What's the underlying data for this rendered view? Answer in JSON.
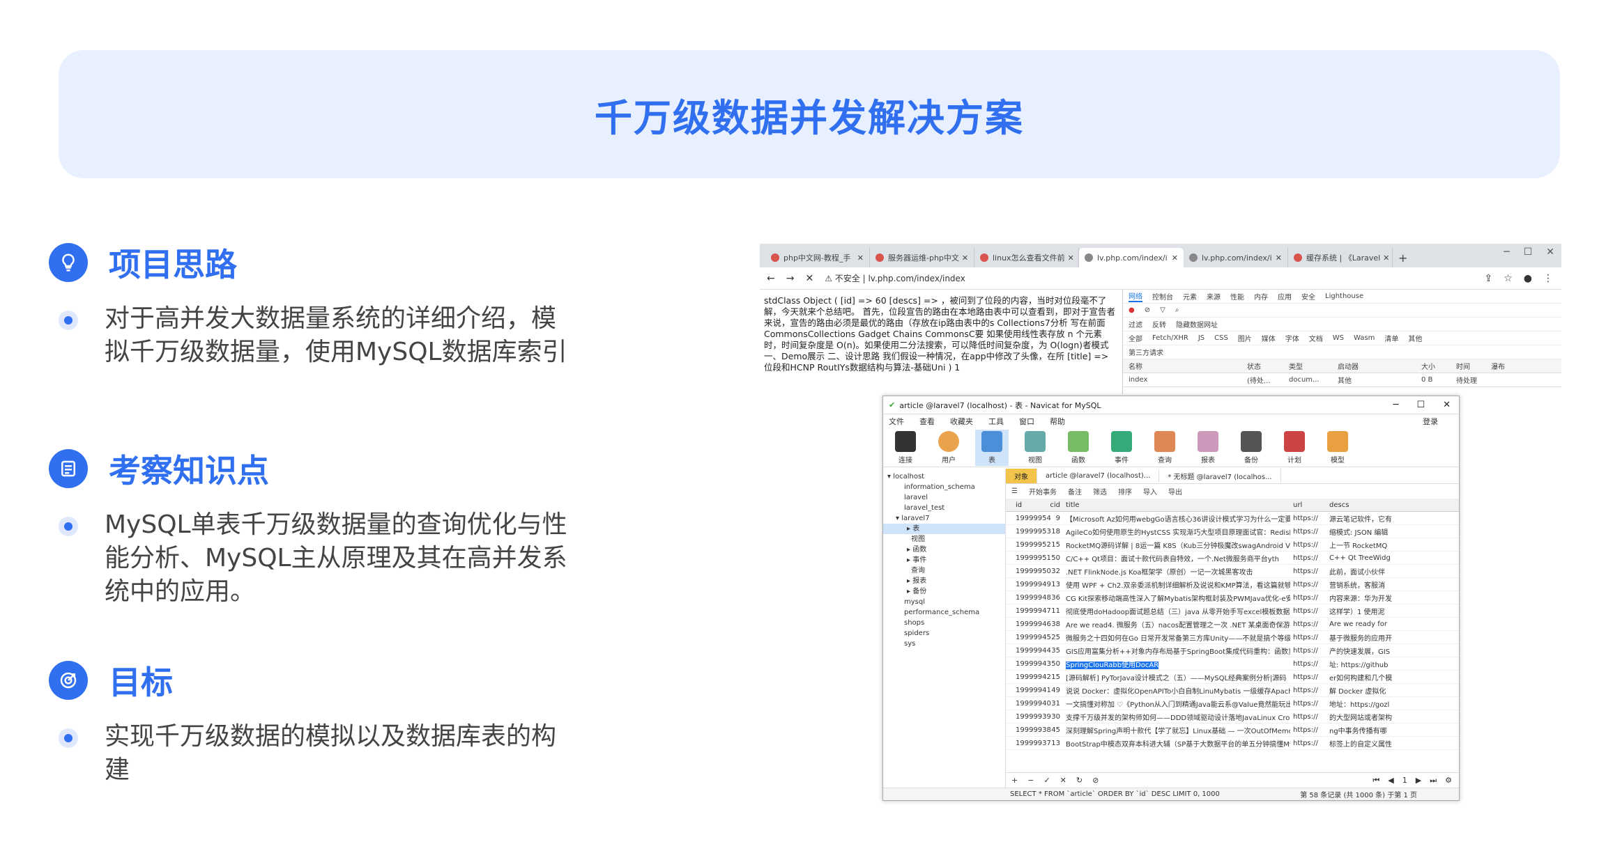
{
  "banner": {
    "title": "千万级数据并发解决方案"
  },
  "sections": [
    {
      "title": "项目思路",
      "icon": "lightbulb-icon",
      "text": "对于高并发大数据量系统的详细介绍，模拟千万级数据量，使用MySQL数据库索引"
    },
    {
      "title": "考察知识点",
      "icon": "list-icon",
      "text": "MySQL单表千万级数据量的查询优化与性能分析、MySQL主从原理及其在高并发系统中的应用。"
    },
    {
      "title": "目标",
      "icon": "target-icon",
      "text": "实现千万级数据的模拟以及数据库表的构建"
    }
  ],
  "browser": {
    "tabs": [
      "php中文网-教程_手",
      "服务器运维-php中文",
      "linux怎么查看文件前",
      "lv.php.com/index/i",
      "lv.php.com/index/i",
      "缓存系统 | 《Laravel"
    ],
    "url_prefix": "不安全",
    "url": "lv.php.com/index/index",
    "page_text": "stdClass Object ( [id] => 60 [descs] => ，被问到了位段的内容，当时对位段毫不了解，今天就来个总结吧。 首先，位段宣告的路由在本地路由表中可以查看到，即对于宣告者来说，宣告的路由必须是最优的路由（存放在ip路由表中的s Collections7分析 写在前面 CommonsCollections Gadget Chains CommonsC要 如果使用线性表存放 n 个元素时，时间复杂度是 O(n)。如果使用二分法搜索，可以降低时间复杂度，为 O(logn)者模式 一、Demo展示 二、设计思路 我们假设一种情况，在app中修改了头像，在所 [title] => 位段和HCNP RoutIYs数据结构与算法-基础Uni ) 1",
    "devtools": {
      "tabs": [
        "网络",
        "控制台",
        "元素",
        "来源",
        "性能",
        "内存",
        "应用",
        "安全",
        "Lighthouse"
      ],
      "filter": "过滤",
      "filter_opts": [
        "反转",
        "隐藏数据网址"
      ],
      "types": [
        "全部",
        "Fetch/XHR",
        "JS",
        "CSS",
        "图片",
        "媒体",
        "字体",
        "文档",
        "WS",
        "Wasm",
        "清单",
        "其他"
      ],
      "third_party": "第三方请求",
      "cols": [
        "名称",
        "状态",
        "类型",
        "启动器",
        "大小",
        "时间",
        "瀑布"
      ],
      "row": [
        "index",
        "(待处...",
        "docum...",
        "其他",
        "0 B",
        "待处理"
      ]
    }
  },
  "navicat": {
    "title": "article @laravel7 (localhost) - 表 - Navicat for MySQL",
    "menu": [
      "文件",
      "查看",
      "收藏夹",
      "工具",
      "窗口",
      "帮助"
    ],
    "login": "登录",
    "tools": [
      "连接",
      "用户",
      "表",
      "视图",
      "函数",
      "事件",
      "查询",
      "报表",
      "备份",
      "计划",
      "模型"
    ],
    "tree": [
      "localhost",
      "information_schema",
      "laravel",
      "laravel_test",
      "laravel7",
      "表",
      "视图",
      "函数",
      "事件",
      "查询",
      "报表",
      "备份",
      "mysql",
      "performance_schema",
      "shops",
      "spiders",
      "sys"
    ],
    "obj_tabs": [
      "对象",
      "article @laravel7 (localhost)...",
      "* 无标题 @laravel7 (localhos..."
    ],
    "toolbar": [
      "开始事务",
      "备注",
      "筛选",
      "排序",
      "导入",
      "导出"
    ],
    "columns": [
      "id",
      "cid",
      "title",
      "url",
      "descs"
    ],
    "rows": [
      [
        "19999954",
        "9",
        "【Microsoft Az如何用webgGo语言核心36讲设计模式学习为什么一定要学习设计模式",
        "https://",
        "源云笔记软件，它有"
      ],
      [
        "19999953",
        "18",
        "AgileCo如何使用原生的HystCSS 实现渐巧大型项目原理面试官：Redis的",
        "https://",
        "缩模式: JSON 编辑"
      ],
      [
        "19999952",
        "15",
        "RocketMQ源码详解 | 8运一篇 K8S（Kub三分钟极魔改swagAndroid View",
        "https://",
        "上一节 RocketMQ"
      ],
      [
        "19999951",
        "50",
        "C/C++ Qt项目：面试十款代码表自特效，一个.Net微服务商平台yth",
        "https://",
        "C++ Qt TreeWidg"
      ],
      [
        "19999950",
        "32",
        ".NET FlinkNode.js Koa框架学（原创）一记一次城黑客攻击",
        "https://",
        "此前，面试小伙伴"
      ],
      [
        "19999949",
        "13",
        "使用 WPF + Ch2.双亲委派机制详细解析及说说和KMP算法，看这篇就够了! vue2+vit",
        "https://",
        "营销系统，客服消"
      ],
      [
        "19999948",
        "36",
        "CG Kit探索移动端高性深入了解Mybatis架构框封装及PWMJava优化-e安装 Ubuntu",
        "https://",
        "内容来源：华为开发"
      ],
      [
        "19999947",
        "11",
        "彻底使用doHadoop面试题总结（三）java 从零开始手写excel模板数据模板",
        "https://",
        "这样学）1 使用泥"
      ],
      [
        "19999946",
        "38",
        "Are we read4. 微服务（五）nacos配置管理之一次 .NET 某桌面奇保游戏NOIP",
        "https://",
        "Are we ready for"
      ],
      [
        "19999945",
        "25",
        "微服务之十四如何在Go 日常开发常备第三方库Unity——不就是搞个等级吗（七）羽要",
        "https://",
        "基于微服务的应用开"
      ],
      [
        "19999944",
        "35",
        "GIS应用富集分析++对象内存布局基于SpringBoot集成代码重构：函数重构的 7 个小",
        "https://",
        "产的快速发展，GIS"
      ],
      [
        "19999943",
        "50",
        "SpringClouRabb使用DocAR",
        "https://",
        "址: https://github"
      ],
      [
        "19999942",
        "15",
        "[源码解析] PyTorJava设计模式之（五）——MySQL经典案例分析|源码【Azure 应用",
        "https://",
        "er如何构建和几个模"
      ],
      [
        "19999941",
        "49",
        "说说 Docker：虚拟化OpenAPITo小白自制LinuMybatis 一级缓存Apache Hudi",
        "https://",
        "解 Docker 虚拟化"
      ],
      [
        "19999940",
        "31",
        "一文搞懂对称加 ♡《Python从入门到精通Java能云系@Value竟然能玩出这的骑转门三",
        "https://",
        "地址：https://gozl"
      ],
      [
        "19999939",
        "30",
        "支撑千万级并发的架构师如何——DDD领域驱动设计落地JavaLinux CronjavaRgR",
        "https://",
        "的大型网站或者架构"
      ],
      [
        "19999938",
        "45",
        "深刻理解Spring声明十款代【学了就忘】Linux基础 — 一次OutOfMemory的一个有趣",
        "https://",
        "ng中事务传播有哪"
      ],
      [
        "19999937",
        "13",
        "BootStrap中模态双弃本科进大辅（SP基于大数据平台的单五分钟搞懂MySQL索引下推",
        "https://",
        "标签上的自定义属性"
      ]
    ],
    "footer_pager": [
      "1"
    ],
    "status_sql": "SELECT * FROM `article` ORDER BY `id` DESC LIMIT 0, 1000",
    "status_right": "第 58 条记录 (共 1000 条) 于第 1 页"
  }
}
